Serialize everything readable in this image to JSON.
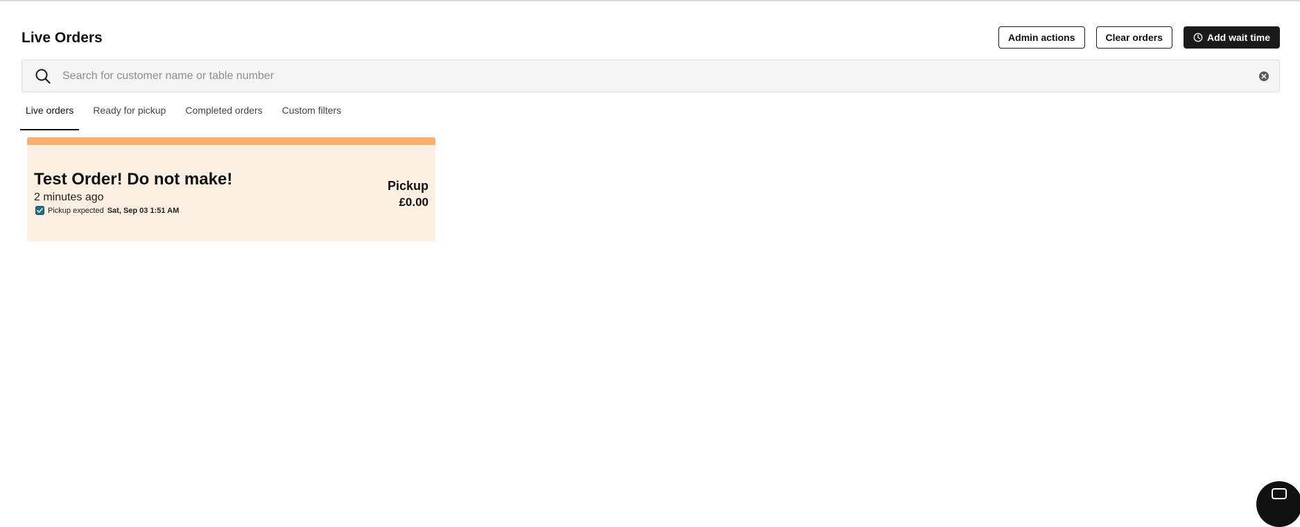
{
  "header": {
    "title": "Live Orders",
    "actions": {
      "admin_label": "Admin actions",
      "clear_label": "Clear orders",
      "wait_label": "Add wait time"
    }
  },
  "search": {
    "placeholder": "Search for customer name or table number",
    "value": ""
  },
  "tabs": [
    {
      "label": "Live orders",
      "active": true
    },
    {
      "label": "Ready for pickup",
      "active": false
    },
    {
      "label": "Completed orders",
      "active": false
    },
    {
      "label": "Custom filters",
      "active": false
    }
  ],
  "orders": [
    {
      "name": "Test Order! Do not make!",
      "time_ago": "2 minutes ago",
      "pickup_prefix": "Pickup expected",
      "pickup_date": "Sat, Sep 03 1:51 AM",
      "type": "Pickup",
      "total": "£0.00",
      "pickup_checked": true
    }
  ],
  "icons": {
    "search": "search-icon",
    "clear": "close-circle-icon",
    "clock": "clock-icon",
    "check": "checkbox-checked-icon",
    "chat": "chat-icon"
  },
  "colors": {
    "card_background": "#fdefe2",
    "card_stripe": "#f9b06f",
    "primary_dark": "#1a1a1a",
    "checkbox": "#1f6f8b"
  }
}
